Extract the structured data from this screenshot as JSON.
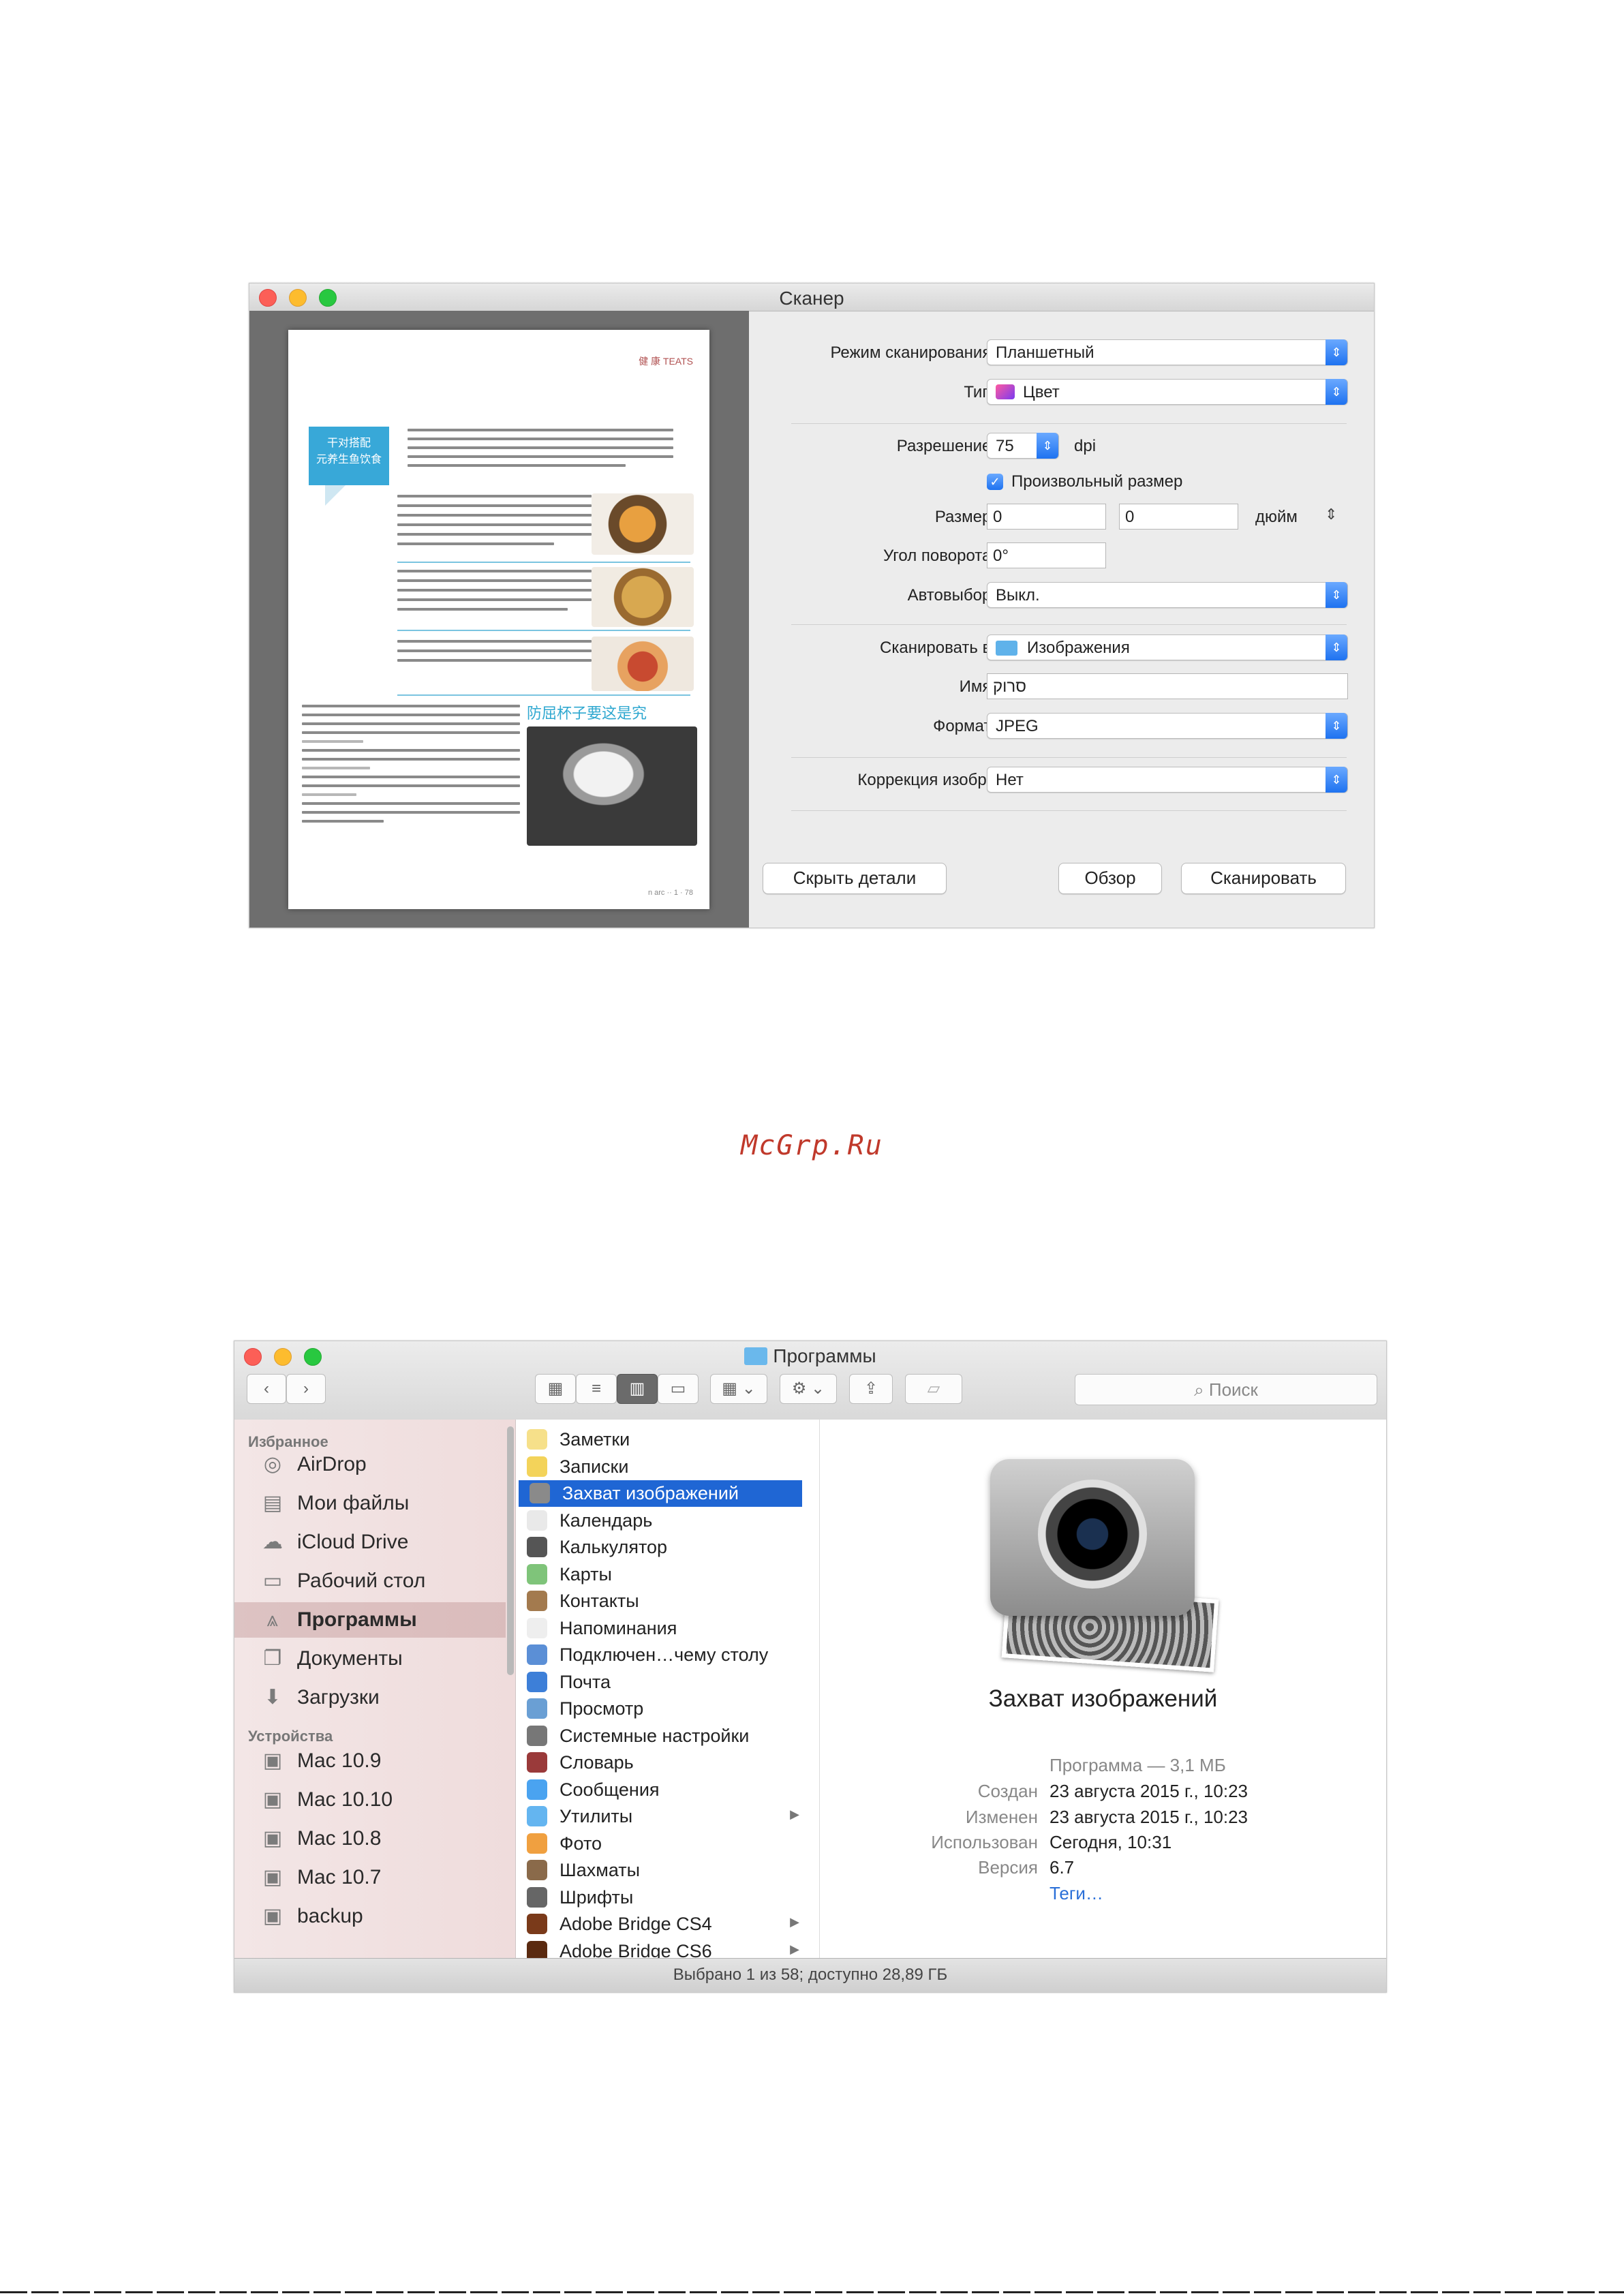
{
  "scanner": {
    "window_title": "Сканер",
    "labels": {
      "scan_mode": "Режим сканирования:",
      "type": "Тип:",
      "resolution": "Разрешение:",
      "size": "Размер:",
      "rotation": "Угол поворота:",
      "autoselect": "Автовыбор:",
      "scan_to": "Сканировать в:",
      "name": "Имя:",
      "format": "Формат:",
      "correction": "Коррекция изобр.:"
    },
    "values": {
      "scan_mode": "Планшетный",
      "type": "Цвет",
      "resolution": "75",
      "resolution_unit": "dpi",
      "custom_size": "Произвольный размер",
      "size_w": "0",
      "size_h": "0",
      "size_unit": "дюйм",
      "rotation": "0°",
      "autoselect": "Выкл.",
      "scan_to": "Изображения",
      "name": "סרוק",
      "format": "JPEG",
      "correction": "Нет"
    },
    "buttons": {
      "hide_details": "Скрыть детали",
      "browse": "Обзор",
      "scan": "Сканировать"
    },
    "preview_doc": {
      "header_tag": "健 康 TEATS",
      "blue_title_line1": "干对搭配",
      "blue_title_line2": "元养生鱼饮食",
      "subhead": "防屈杯子要这是究",
      "footer": "n arc ·· 1 · 78"
    }
  },
  "watermark": "McGrp.Ru",
  "finder": {
    "window_title": "Программы",
    "search_placeholder": "Поиск",
    "sidebar": {
      "favorites_header": "Избранное",
      "favorites": [
        {
          "label": "AirDrop",
          "icon": "airdrop-icon"
        },
        {
          "label": "Мои файлы",
          "icon": "all-files-icon"
        },
        {
          "label": "iCloud Drive",
          "icon": "cloud-icon"
        },
        {
          "label": "Рабочий стол",
          "icon": "desktop-icon"
        },
        {
          "label": "Программы",
          "icon": "applications-icon"
        },
        {
          "label": "Документы",
          "icon": "documents-icon"
        },
        {
          "label": "Загрузки",
          "icon": "downloads-icon"
        }
      ],
      "devices_header": "Устройства",
      "devices": [
        {
          "label": "Mac 10.9",
          "icon": "disk-icon"
        },
        {
          "label": "Mac 10.10",
          "icon": "disk-icon"
        },
        {
          "label": "Mac 10.8",
          "icon": "disk-icon"
        },
        {
          "label": "Mac 10.7",
          "icon": "disk-icon"
        },
        {
          "label": "backup",
          "icon": "disk-icon"
        }
      ]
    },
    "apps": [
      {
        "label": "Заметки",
        "color": "#f6e08a"
      },
      {
        "label": "Записки",
        "color": "#f3d35a"
      },
      {
        "label": "Захват изображений",
        "color": "#8a8a8a"
      },
      {
        "label": "Календарь",
        "color": "#e9e9e9"
      },
      {
        "label": "Калькулятор",
        "color": "#555555"
      },
      {
        "label": "Карты",
        "color": "#7fc47a"
      },
      {
        "label": "Контакты",
        "color": "#a37a4e"
      },
      {
        "label": "Напоминания",
        "color": "#eeeeee"
      },
      {
        "label": "Подключен…чему столу",
        "color": "#5b8fd6"
      },
      {
        "label": "Почта",
        "color": "#3d7fd8"
      },
      {
        "label": "Просмотр",
        "color": "#6a9fd4"
      },
      {
        "label": "Системные настройки",
        "color": "#777777"
      },
      {
        "label": "Словарь",
        "color": "#9a3a3a"
      },
      {
        "label": "Сообщения",
        "color": "#4aa3f0"
      },
      {
        "label": "Утилиты",
        "color": "#64b5f0"
      },
      {
        "label": "Фото",
        "color": "#f0a040"
      },
      {
        "label": "Шахматы",
        "color": "#8a6a4a"
      },
      {
        "label": "Шрифты",
        "color": "#666666"
      },
      {
        "label": "Adobe Bridge CS4",
        "color": "#7a3a1a"
      },
      {
        "label": "Adobe Bridge CS6",
        "color": "#5a2a10"
      }
    ],
    "preview": {
      "app_name": "Захват изображений",
      "kind": "Программа — 3,1 МБ",
      "created_label": "Создан",
      "created": "23 августа 2015 г., 10:23",
      "modified_label": "Изменен",
      "modified": "23 августа 2015 г., 10:23",
      "used_label": "Использован",
      "used": "Сегодня, 10:31",
      "version_label": "Версия",
      "version": "6.7",
      "tags": "Теги…"
    },
    "status": "Выбрано 1 из 58; доступно 28,89 ГБ"
  }
}
